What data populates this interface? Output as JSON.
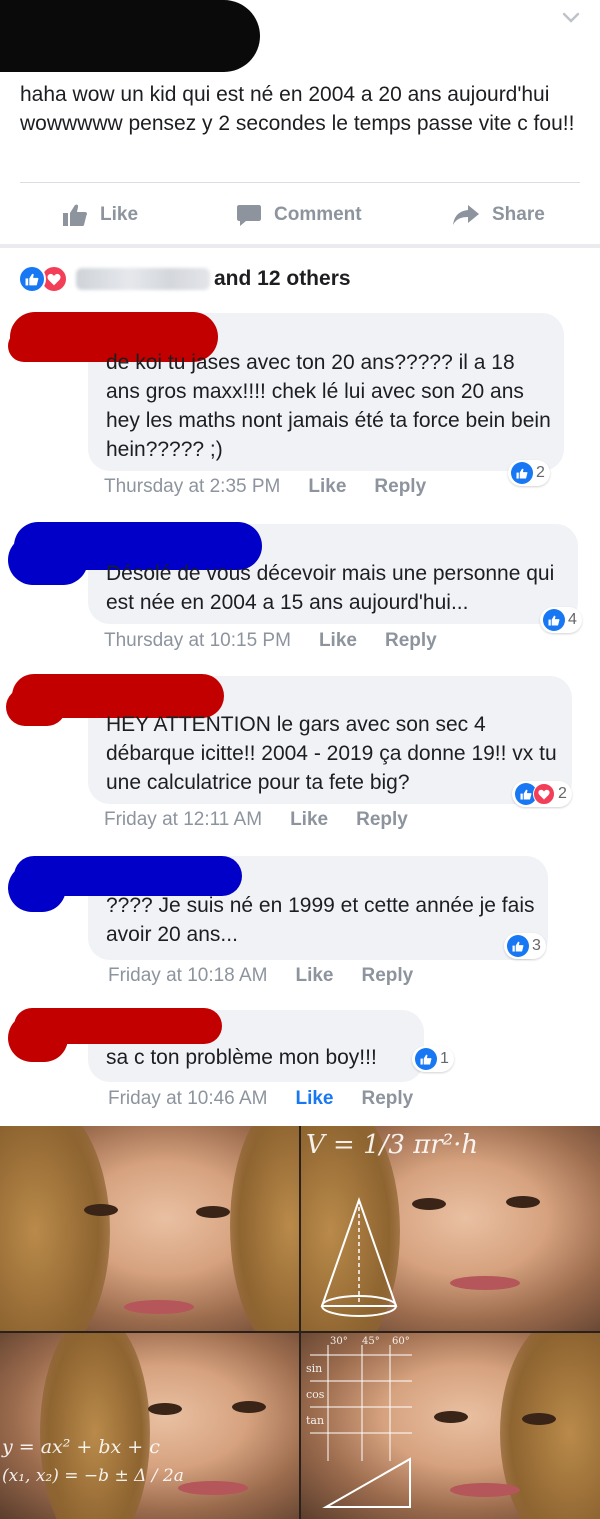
{
  "post": {
    "text": "haha wow un kid qui est né en 2004 a 20 ans aujourd'hui wowwwww pensez y 2 secondes le temps passe vite c fou!!",
    "actions": {
      "like": "Like",
      "comment": "Comment",
      "share": "Share"
    }
  },
  "reactions": {
    "summary": "and 12 others"
  },
  "comments": [
    {
      "text": "de koi tu jases avec ton 20 ans????? il a 18 ans gros maxx!!!! chek lé lui avec son 20 ans hey les maths nont jamais été ta force bein bein hein????? ;)",
      "time": "Thursday at 2:35 PM",
      "like": "Like",
      "reply": "Reply",
      "reaction_count": "2"
    },
    {
      "text": "Désolé de vous décevoir mais une personne qui est née en 2004 a 15 ans aujourd'hui...",
      "time": "Thursday at 10:15 PM",
      "like": "Like",
      "reply": "Reply",
      "reaction_count": "4"
    },
    {
      "text": "HEY ATTENTION le gars avec son sec 4 débarque icitte!! 2004 - 2019 ça donne 19!! vx tu une calculatrice pour ta fete big?",
      "time": "Friday at 12:11 AM",
      "like": "Like",
      "reply": "Reply",
      "reaction_count": "2"
    },
    {
      "text": "???? Je suis né en 1999 et cette année je fais avoir 20 ans...",
      "time": "Friday at 10:18 AM",
      "like": "Like",
      "reply": "Reply",
      "reaction_count": "3"
    },
    {
      "text": "sa c ton problème mon boy!!!",
      "time": "Friday at 10:46 AM",
      "like": "Like",
      "reply": "Reply",
      "reaction_count": "1"
    }
  ],
  "meme": {
    "formulas": {
      "volume": "V = 1/3 πr²·h",
      "quadratic": "y = ax² + bx + c",
      "roots": "(x₁, x₂) = −b ± Δ / 2a",
      "sin": "sin",
      "cos": "cos",
      "tan": "tan",
      "angle30": "30°",
      "angle45": "45°",
      "angle60": "60°"
    }
  },
  "colors": {
    "like_blue": "#1877f2",
    "love_red": "#f33e58",
    "bubble_gray": "#f0f2f5",
    "muted_text": "#8d949e",
    "redact_red": "#c20000",
    "redact_blue": "#0000c8"
  }
}
